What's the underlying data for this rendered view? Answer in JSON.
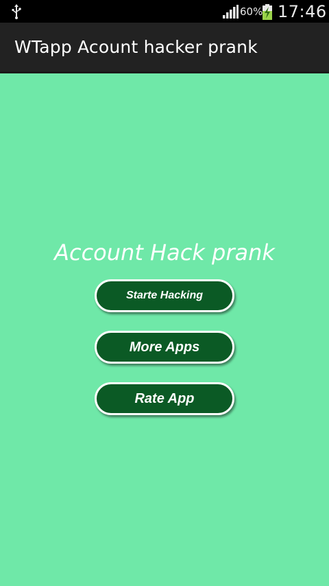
{
  "status_bar": {
    "battery_percent": "60%",
    "time": "17:46",
    "icons": [
      "usb-icon",
      "signal-icon",
      "battery-charging-icon"
    ]
  },
  "action_bar": {
    "title": "WTapp Acount hacker prank"
  },
  "main": {
    "title": "Account Hack prank",
    "buttons": {
      "start_hacking": "Starte Hacking",
      "more_apps": "More Apps",
      "rate_app": "Rate App"
    }
  },
  "colors": {
    "background": "#6fe8a8",
    "button_fill": "#0b5a25",
    "button_border": "#ffffff",
    "action_bar": "#222222",
    "status_bar": "#000000"
  }
}
